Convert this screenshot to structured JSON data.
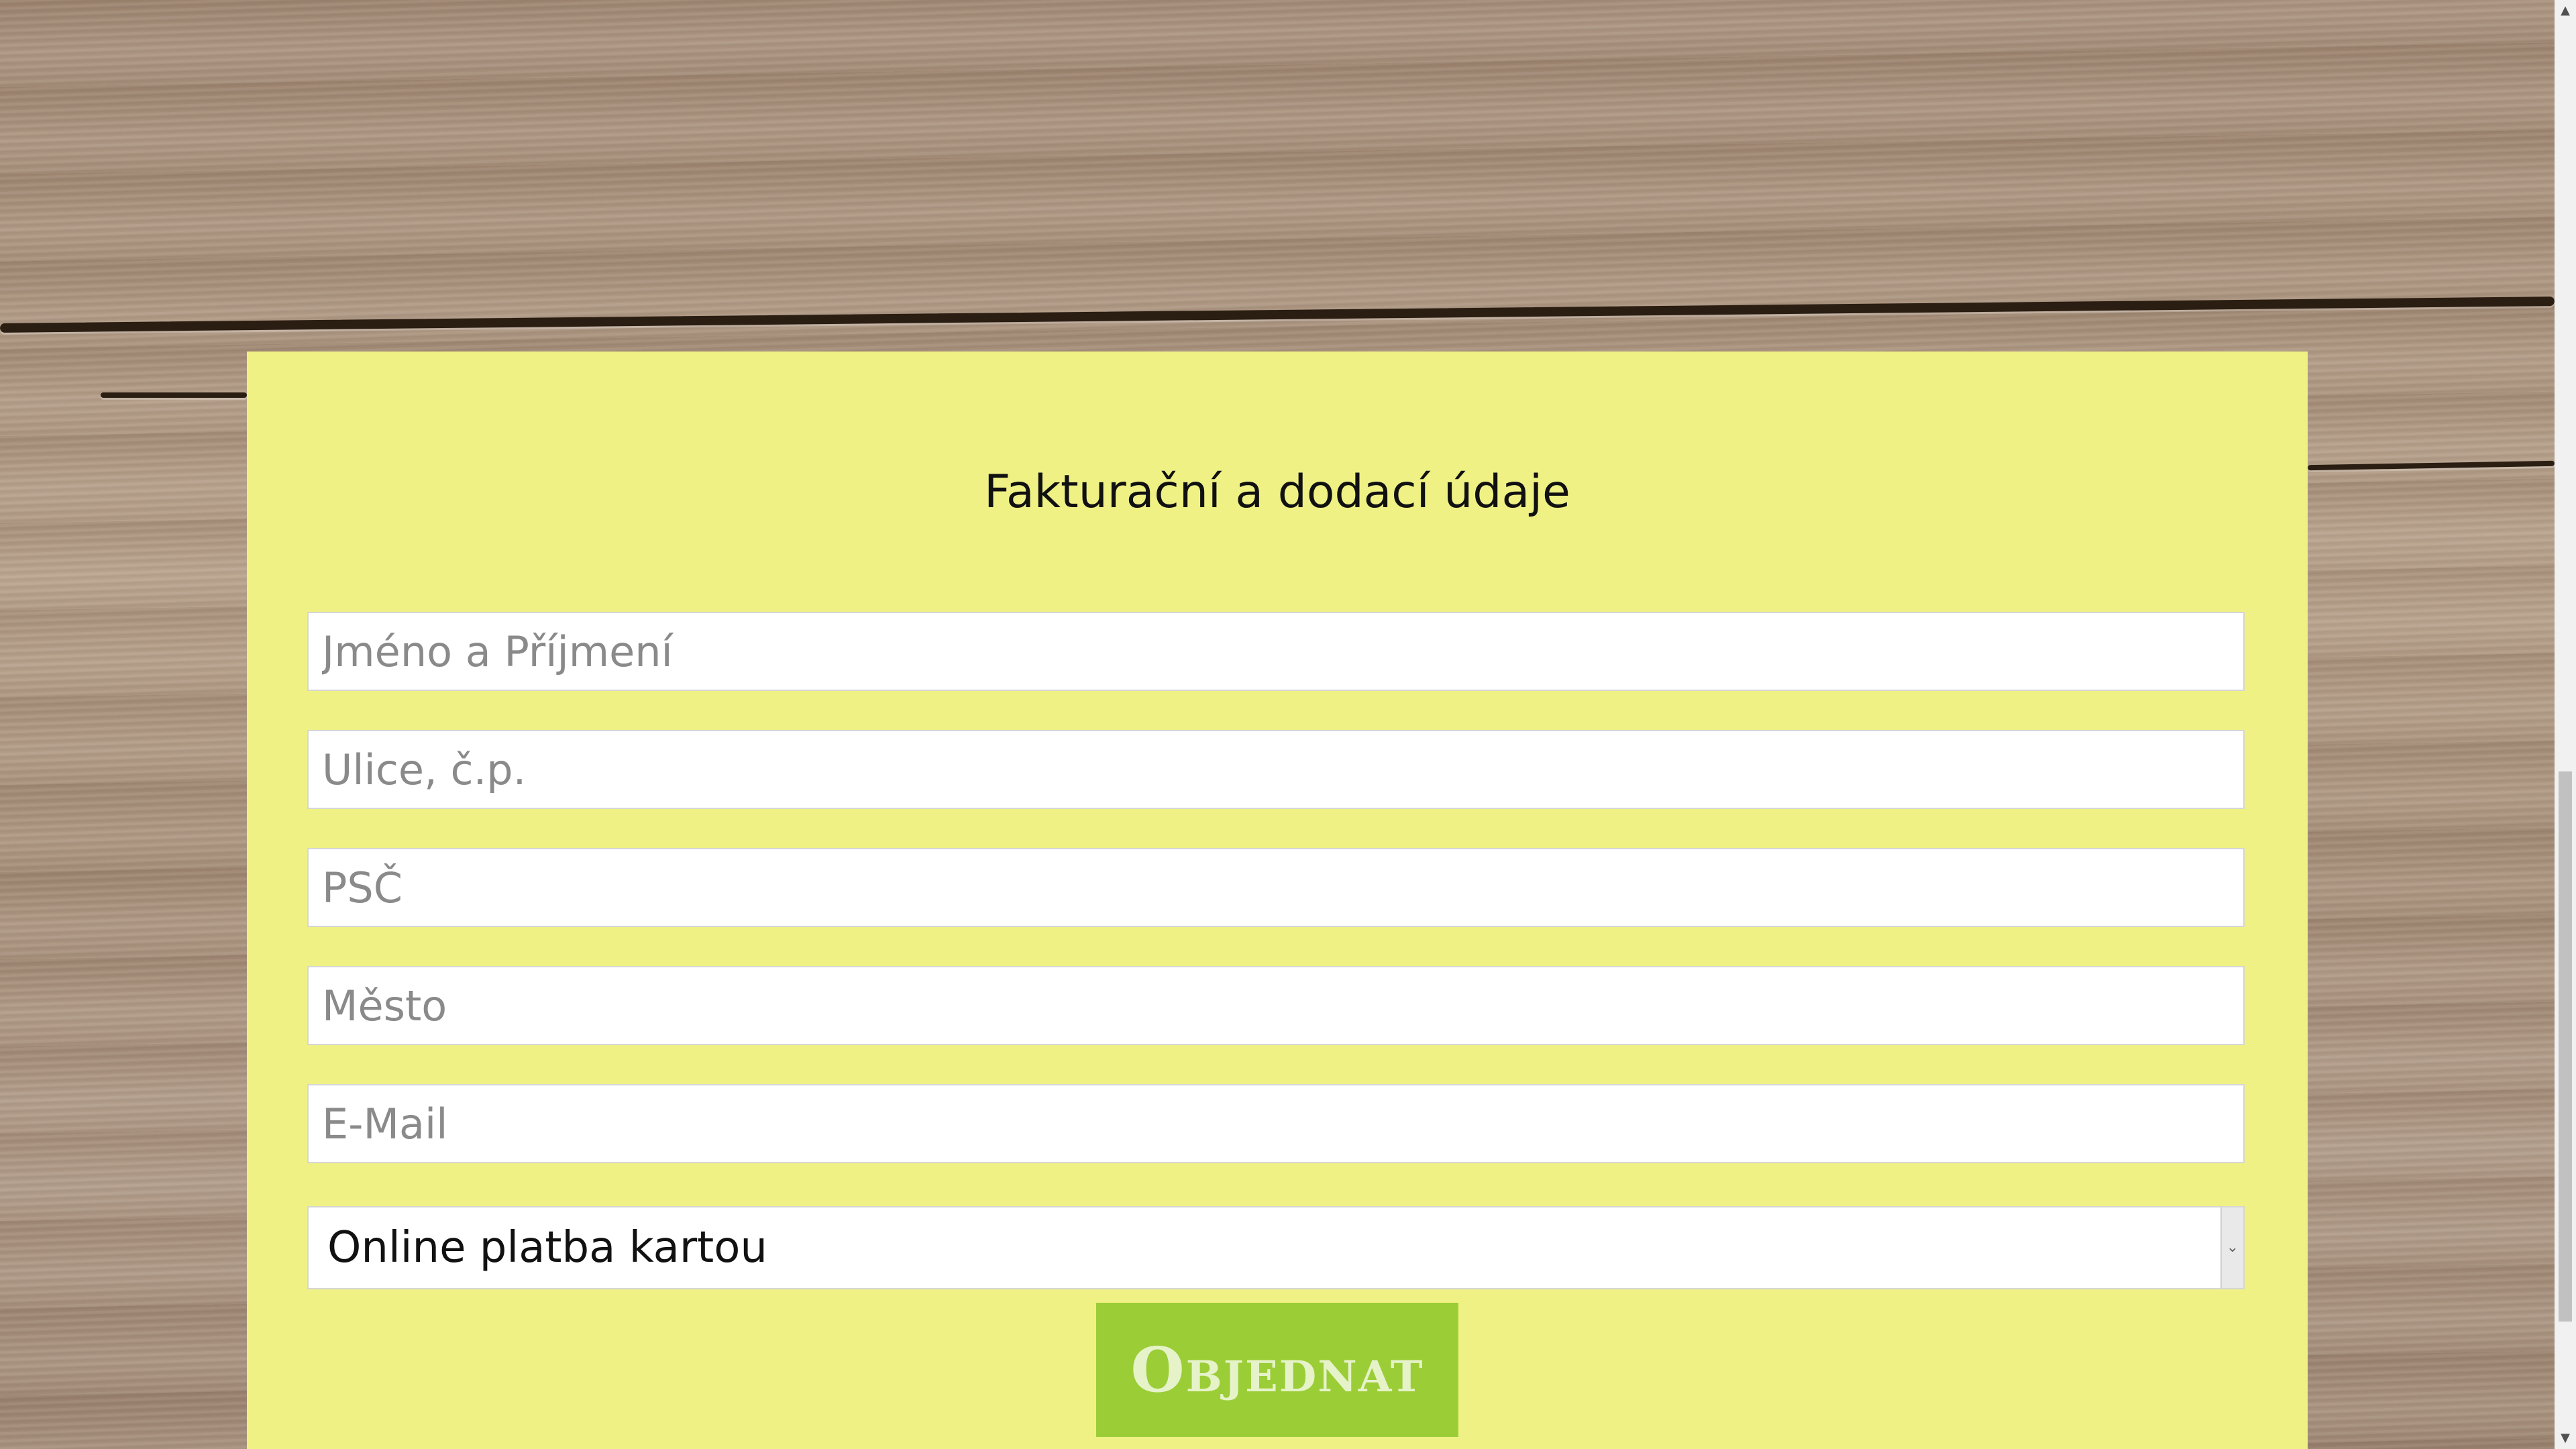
{
  "form": {
    "title": "Fakturační a dodací údaje",
    "fields": [
      {
        "placeholder": "Jméno a Příjmení",
        "value": ""
      },
      {
        "placeholder": "Ulice, č.p.",
        "value": ""
      },
      {
        "placeholder": "PSČ",
        "value": ""
      },
      {
        "placeholder": "Město",
        "value": ""
      },
      {
        "placeholder": "E-Mail",
        "value": ""
      }
    ],
    "payment_select": {
      "selected": "Online platba kartou"
    },
    "submit_label": "Objednat"
  },
  "colors": {
    "panel": "#eff185",
    "button": "#9bcd37",
    "button_text": "#e6f3c9"
  }
}
